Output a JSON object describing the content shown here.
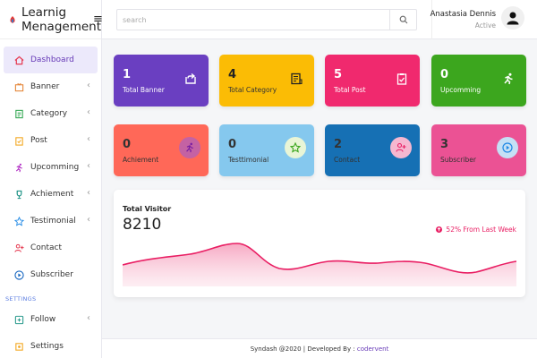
{
  "brand": {
    "line1": "Learnig",
    "line2": "Menagement"
  },
  "search": {
    "placeholder": "search"
  },
  "user": {
    "name": "Anastasia Dennis",
    "status": "Active"
  },
  "sidebar": {
    "items": [
      {
        "label": "Dashboard",
        "icon": "home-icon",
        "active": true,
        "chevron": false
      },
      {
        "label": "Banner",
        "icon": "banner-icon",
        "chevron": true
      },
      {
        "label": "Category",
        "icon": "category-icon",
        "chevron": true
      },
      {
        "label": "Post",
        "icon": "post-icon",
        "chevron": true
      },
      {
        "label": "Upcomming",
        "icon": "running-icon",
        "chevron": true
      },
      {
        "label": "Achiement",
        "icon": "trophy-icon",
        "chevron": true
      },
      {
        "label": "Testimonial",
        "icon": "star-icon",
        "chevron": true
      },
      {
        "label": "Contact",
        "icon": "add-user-icon",
        "chevron": false
      },
      {
        "label": "Subscriber",
        "icon": "play-circle-icon",
        "chevron": false
      }
    ],
    "section_label": "SETTINGS",
    "settings_items": [
      {
        "label": "Follow",
        "icon": "follow-icon",
        "chevron": true
      },
      {
        "label": "Settings",
        "icon": "settings-icon",
        "chevron": false
      }
    ]
  },
  "cards_row1": [
    {
      "value": "1",
      "label": "Total Banner",
      "color": "#6a3fc1",
      "icon": "share-icon"
    },
    {
      "value": "4",
      "label": "Total Category",
      "color": "#fbbc05",
      "icon": "category-doc-icon"
    },
    {
      "value": "5",
      "label": "Total Post",
      "color": "#f0296e",
      "icon": "clipboard-check-icon"
    },
    {
      "value": "0",
      "label": "Upcomming",
      "color": "#3ca61e",
      "icon": "running-icon"
    }
  ],
  "cards_row2": [
    {
      "value": "0",
      "label": "Achiement",
      "color": "#ff6858",
      "icon": "running-icon",
      "circle": "#c462a3"
    },
    {
      "value": "0",
      "label": "Testtimonial",
      "color": "#85c8ee",
      "icon": "star-icon",
      "circle": "#e9f5d6"
    },
    {
      "value": "2",
      "label": "Contact",
      "color": "#1670b4",
      "icon": "add-user-icon",
      "circle": "#f6b7d0"
    },
    {
      "value": "3",
      "label": "Subscriber",
      "color": "#eb5294",
      "icon": "play-circle-icon",
      "circle": "#c5e0f5"
    }
  ],
  "visitor": {
    "title": "Total Visitor",
    "value": "8210",
    "change": "52% From Last Week",
    "accent": "#e91e63"
  },
  "footer": {
    "text": "Syndash @2020 | Developed By : ",
    "dev": "codervent"
  }
}
